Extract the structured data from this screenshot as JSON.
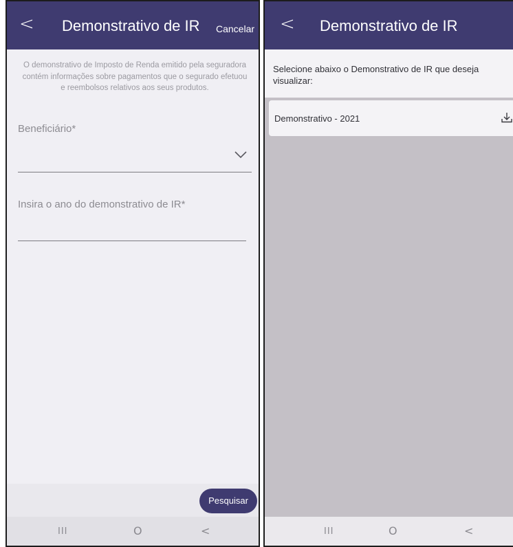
{
  "left_screen": {
    "header": {
      "back_symbol": "<",
      "title": "Demonstrativo de IR",
      "cancel_label": "Cancelar"
    },
    "intro_text": "O demonstrativo de Imposto de Renda emitido pela seguradora contém informações sobre pagamentos que o segurado efetuou e reembolsos relativos aos seus produtos.",
    "beneficiario": {
      "label": "Beneficiário*",
      "value": ""
    },
    "ano": {
      "label": "Insira o ano do demonstrativo de IR*",
      "value": ""
    },
    "search_button_label": "Pesquisar",
    "navbar": {
      "recent": "III",
      "home": "O",
      "back": "<"
    }
  },
  "right_screen": {
    "header": {
      "back_symbol": "<",
      "title": "Demonstrativo de IR"
    },
    "instruction": "Selecione abaixo o Demonstrativo de IR que deseja visualizar:",
    "documents": [
      {
        "label": "Demonstrativo - 2021",
        "icon": "download-icon"
      }
    ],
    "navbar": {
      "recent": "III",
      "home": "O",
      "back": "<"
    }
  },
  "colors": {
    "header": "#3f3b70",
    "left_background": "#f0eff4",
    "right_background": "#c4c0c6",
    "button": "#3f3b70"
  }
}
